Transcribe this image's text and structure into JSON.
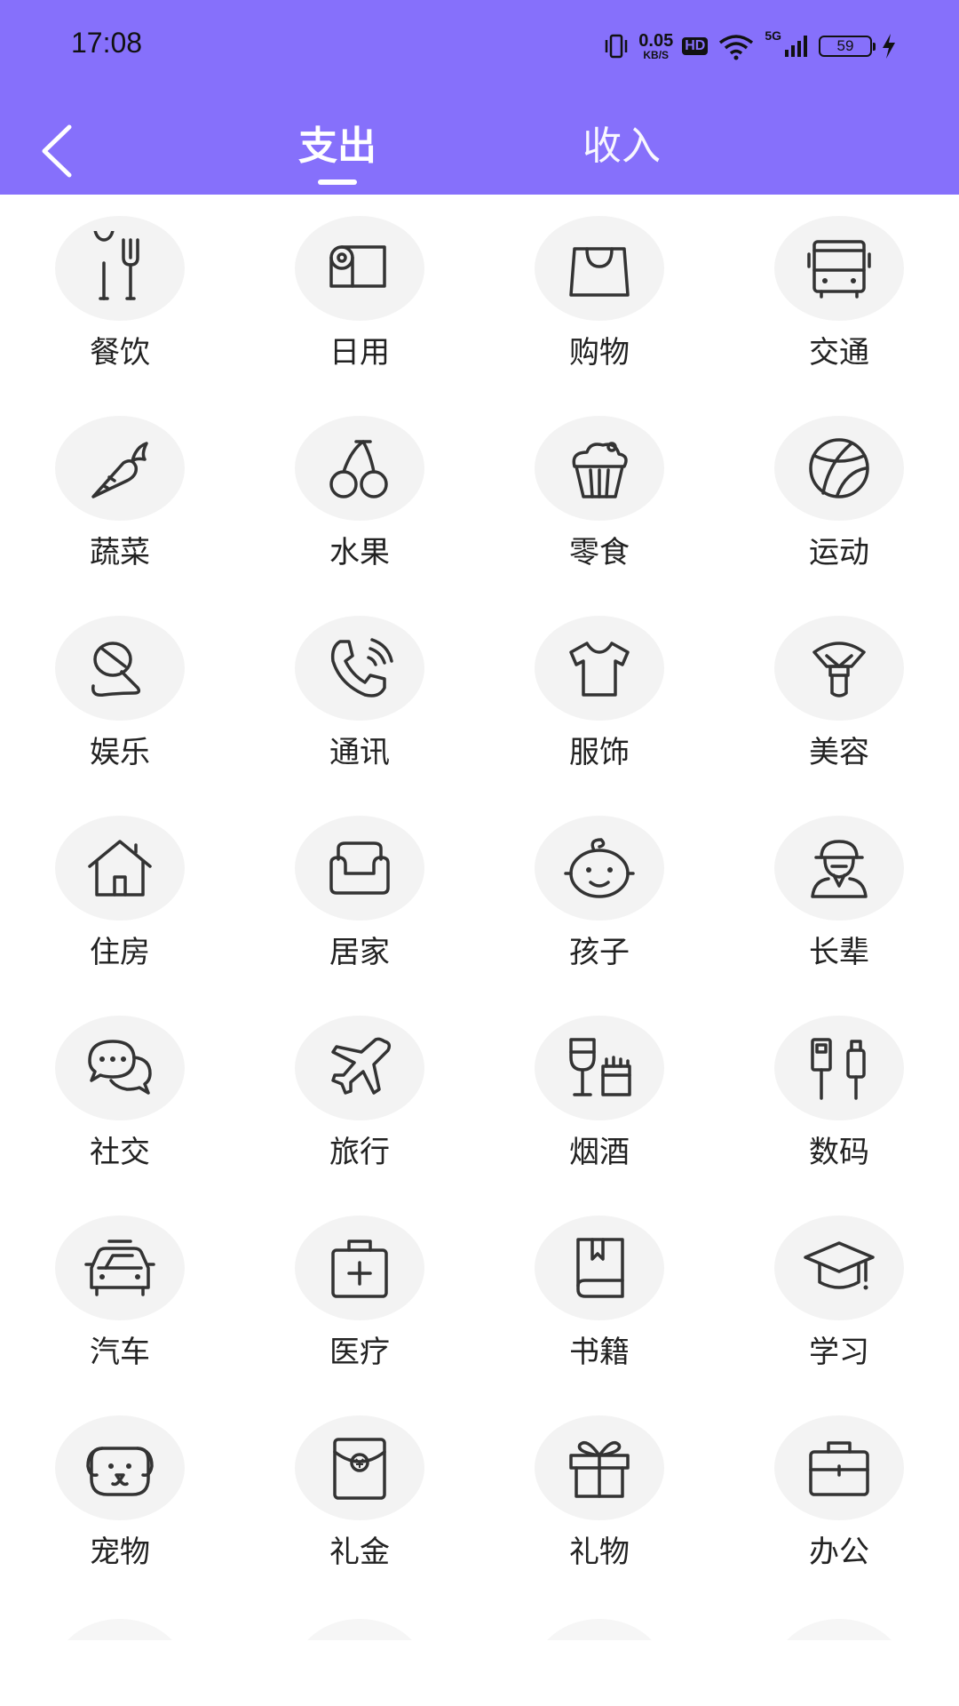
{
  "status": {
    "time": "17:08",
    "speed_value": "0.05",
    "speed_unit": "KB/S",
    "hd": "HD",
    "network": "5G",
    "battery": "59"
  },
  "header": {
    "tabs": [
      {
        "label": "支出",
        "active": true
      },
      {
        "label": "收入",
        "active": false
      }
    ]
  },
  "colors": {
    "accent": "#8670fb",
    "icon_bg": "#f3f3f3",
    "icon_stroke": "#333333"
  },
  "categories": [
    {
      "label": "餐饮",
      "icon": "cutlery-icon"
    },
    {
      "label": "日用",
      "icon": "tissue-roll-icon"
    },
    {
      "label": "购物",
      "icon": "shopping-bag-icon"
    },
    {
      "label": "交通",
      "icon": "bus-icon"
    },
    {
      "label": "蔬菜",
      "icon": "carrot-icon"
    },
    {
      "label": "水果",
      "icon": "cherry-icon"
    },
    {
      "label": "零食",
      "icon": "cupcake-icon"
    },
    {
      "label": "运动",
      "icon": "basketball-icon"
    },
    {
      "label": "娱乐",
      "icon": "microphone-icon"
    },
    {
      "label": "通讯",
      "icon": "phone-icon"
    },
    {
      "label": "服饰",
      "icon": "tshirt-icon"
    },
    {
      "label": "美容",
      "icon": "lipstick-icon"
    },
    {
      "label": "住房",
      "icon": "house-icon"
    },
    {
      "label": "居家",
      "icon": "sofa-icon"
    },
    {
      "label": "孩子",
      "icon": "baby-icon"
    },
    {
      "label": "长辈",
      "icon": "elder-icon"
    },
    {
      "label": "社交",
      "icon": "chat-icon"
    },
    {
      "label": "旅行",
      "icon": "airplane-icon"
    },
    {
      "label": "烟酒",
      "icon": "wine-icon"
    },
    {
      "label": "数码",
      "icon": "usb-cable-icon"
    },
    {
      "label": "汽车",
      "icon": "car-icon"
    },
    {
      "label": "医疗",
      "icon": "medical-kit-icon"
    },
    {
      "label": "书籍",
      "icon": "book-icon"
    },
    {
      "label": "学习",
      "icon": "graduation-cap-icon"
    },
    {
      "label": "宠物",
      "icon": "dog-icon"
    },
    {
      "label": "礼金",
      "icon": "red-envelope-icon"
    },
    {
      "label": "礼物",
      "icon": "gift-icon"
    },
    {
      "label": "办公",
      "icon": "briefcase-icon"
    }
  ]
}
